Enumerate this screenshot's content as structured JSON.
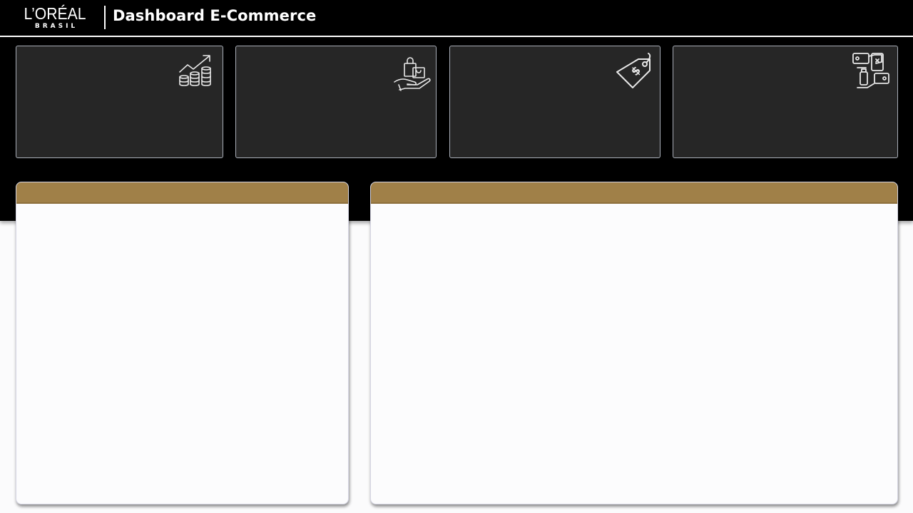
{
  "header": {
    "logo_text": "L’ORÉAL",
    "logo_subtext": "BRASIL",
    "title": "Dashboard E-Commerce"
  },
  "kpi_cards": [
    {
      "icon": "revenue-growth-icon"
    },
    {
      "icon": "shopping-bag-hand-icon"
    },
    {
      "icon": "price-tag-icon"
    },
    {
      "icon": "money-exchange-icon"
    }
  ],
  "panels": [
    {
      "title": ""
    },
    {
      "title": ""
    }
  ],
  "colors": {
    "header_bg": "#000000",
    "card_bg": "#262626",
    "card_border": "#a9aeb8",
    "panel_header": "#a08048",
    "panel_bg": "#fcfcfd"
  }
}
